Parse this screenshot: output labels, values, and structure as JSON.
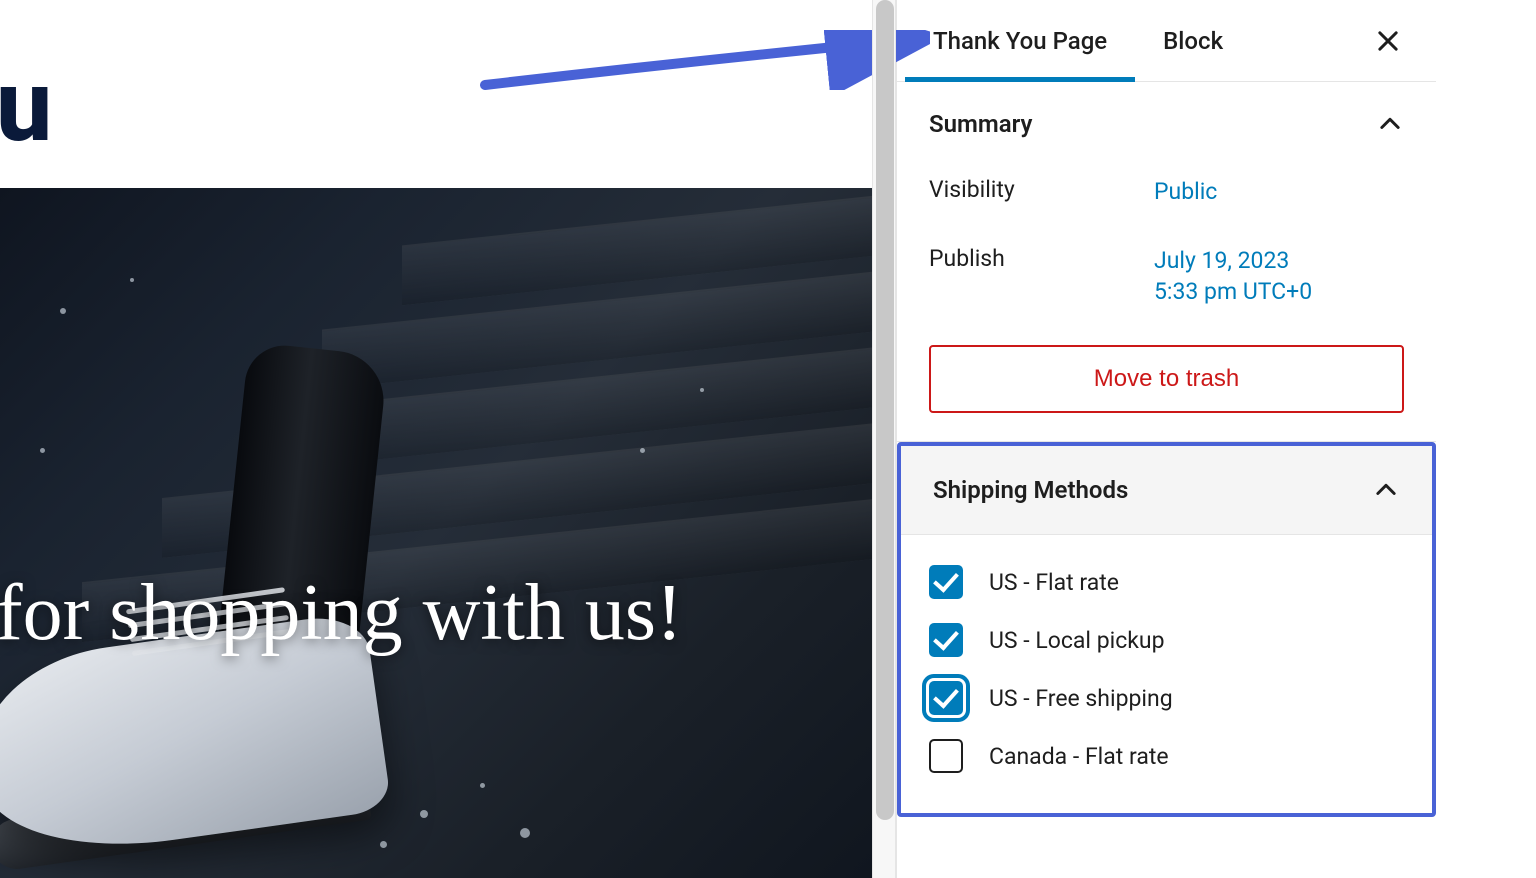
{
  "main": {
    "hero_text": "for shopping with us!"
  },
  "sidebar": {
    "tabs": {
      "thank_you": "Thank You Page",
      "block": "Block"
    },
    "summary": {
      "title": "Summary",
      "visibility_label": "Visibility",
      "visibility_value": "Public",
      "publish_label": "Publish",
      "publish_value_line1": "July 19, 2023",
      "publish_value_line2": "5:33 pm UTC+0",
      "trash_label": "Move to trash"
    },
    "shipping": {
      "title": "Shipping Methods",
      "options": [
        {
          "label": "US - Flat rate",
          "checked": true,
          "focused": false
        },
        {
          "label": "US - Local pickup",
          "checked": true,
          "focused": false
        },
        {
          "label": "US - Free shipping",
          "checked": true,
          "focused": true
        },
        {
          "label": "Canada - Flat rate",
          "checked": false,
          "focused": false
        }
      ]
    }
  }
}
